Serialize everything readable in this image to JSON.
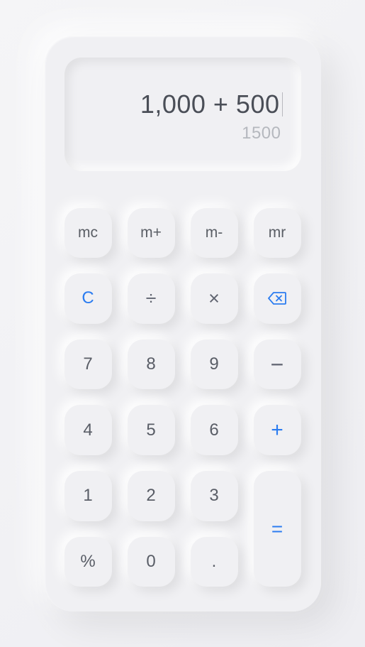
{
  "display": {
    "expression": "1,000 + 500",
    "result": "1500"
  },
  "buttons": {
    "mc": "mc",
    "mplus": "m+",
    "mminus": "m-",
    "mr": "mr",
    "clear": "C",
    "divide": "÷",
    "multiply": "×",
    "backspace": "⌫",
    "seven": "7",
    "eight": "8",
    "nine": "9",
    "minus": "−",
    "four": "4",
    "five": "5",
    "six": "6",
    "plus": "+",
    "one": "1",
    "two": "2",
    "three": "3",
    "equals": "=",
    "percent": "%",
    "zero": "0",
    "decimal": "."
  },
  "colors": {
    "accent": "#2b7cf0",
    "surface": "#f0f0f3",
    "text_primary": "#4a4e57",
    "text_secondary": "#b5b8be",
    "text_button": "#595d66"
  }
}
